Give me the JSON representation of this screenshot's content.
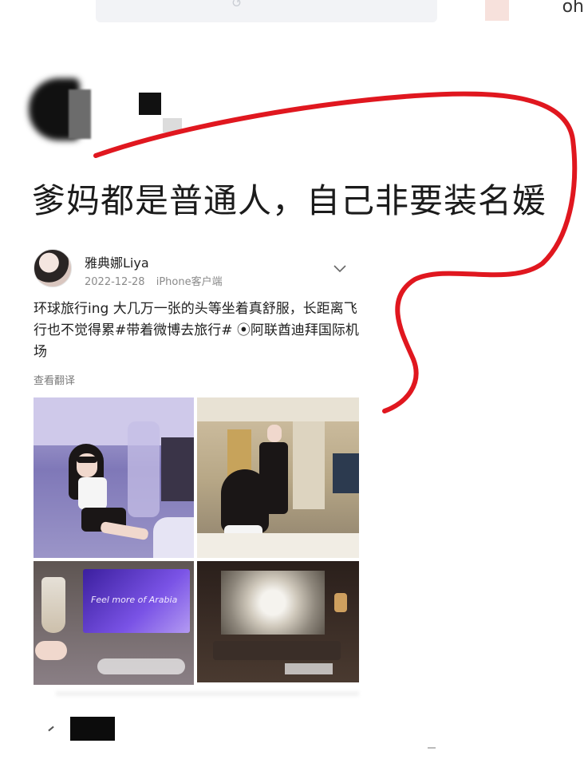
{
  "caption": "爹妈都是普通人，自己非要装名媛",
  "post": {
    "author": "雅典娜Liya",
    "date": "2022-12-28",
    "device": "iPhone客户端",
    "text": "环球旅行ing 大几万一张的头等坐着真舒服，长距离飞行也不觉得累#带着微博去旅行# ⦿阿联酋迪拜国际机场",
    "translate": "查看翻译",
    "screen_text": "Feel more of Arabia"
  },
  "colors": {
    "annotation": "#e0171f",
    "text": "#1b1b1b",
    "meta": "#8a8a8a"
  },
  "icons": {
    "menu": "chevron-down-icon",
    "location": "location-pin-icon"
  }
}
